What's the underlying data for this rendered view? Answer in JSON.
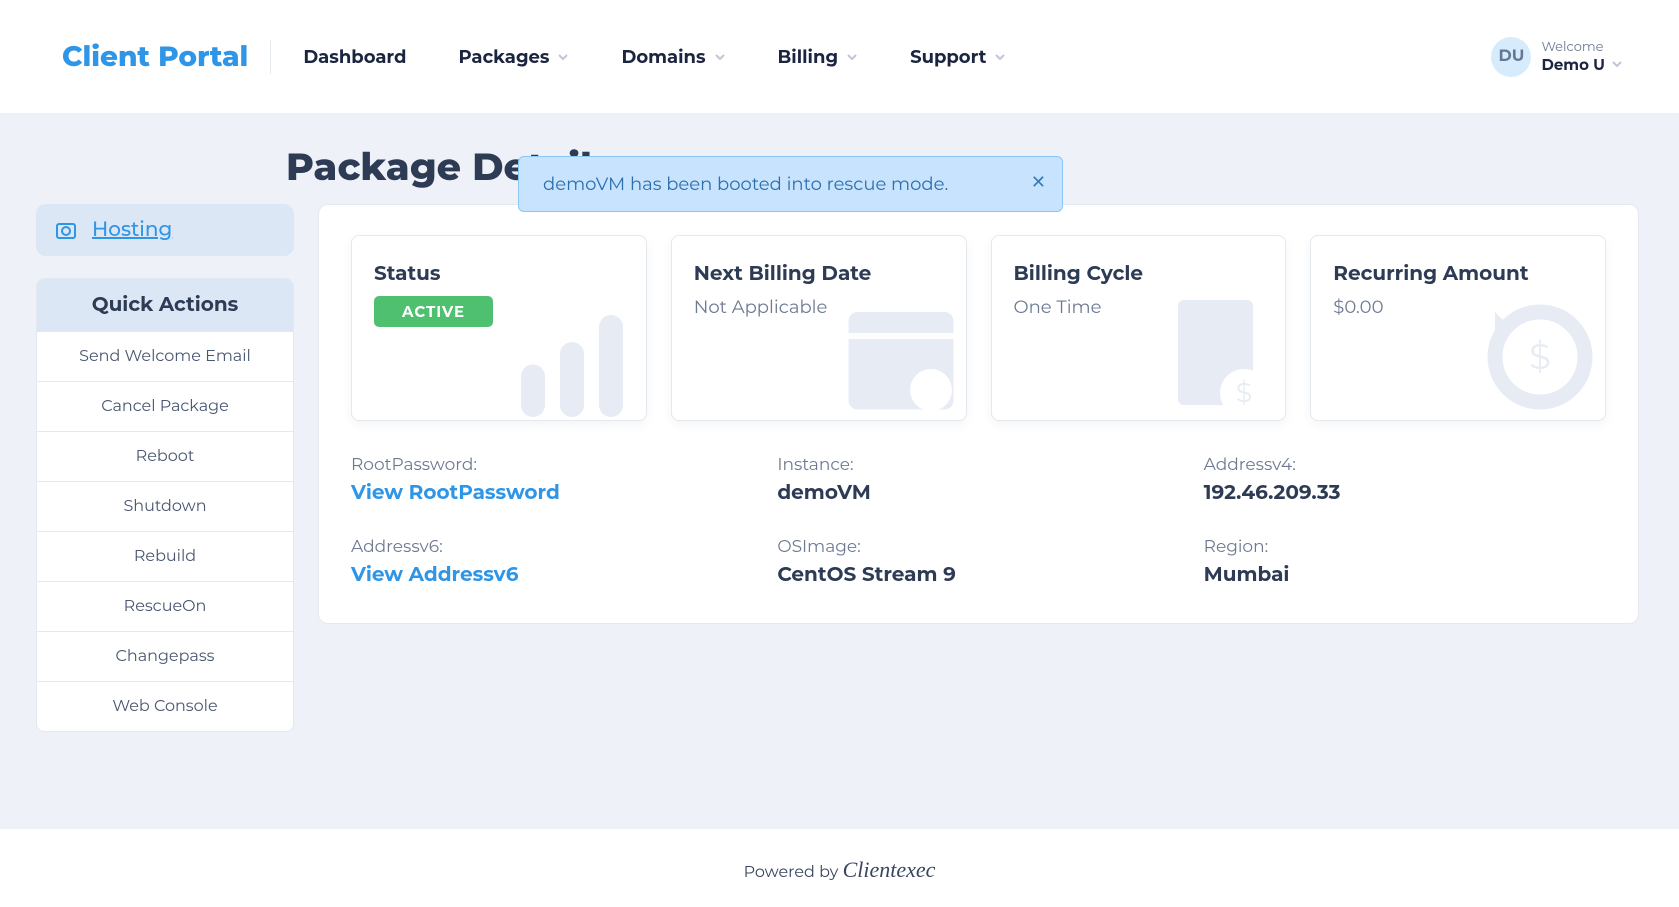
{
  "brand": "Client Portal",
  "nav": {
    "items": [
      {
        "label": "Dashboard",
        "dropdown": false
      },
      {
        "label": "Packages",
        "dropdown": true
      },
      {
        "label": "Domains",
        "dropdown": true
      },
      {
        "label": "Billing",
        "dropdown": true
      },
      {
        "label": "Support",
        "dropdown": true
      }
    ]
  },
  "user": {
    "welcome": "Welcome",
    "name": "Demo U",
    "initials": "DU"
  },
  "page_title": "Package Details",
  "sidebar": {
    "hosting_label": "Hosting",
    "quick_actions_title": "Quick Actions",
    "quick_actions": [
      "Send Welcome Email",
      "Cancel Package",
      "Reboot",
      "Shutdown",
      "Rebuild",
      "RescueOn",
      "Changepass",
      "Web Console"
    ]
  },
  "alert": {
    "message": "demoVM has been booted into rescue mode."
  },
  "cards": {
    "status": {
      "title": "Status",
      "badge": "ACTIVE"
    },
    "next_bill": {
      "title": "Next Billing Date",
      "value": "Not Applicable"
    },
    "cycle": {
      "title": "Billing Cycle",
      "value": "One Time"
    },
    "recurring": {
      "title": "Recurring Amount",
      "value": "$0.00"
    }
  },
  "details": {
    "root_password": {
      "label": "RootPassword:",
      "link_text": "View RootPassword"
    },
    "instance": {
      "label": "Instance:",
      "value": "demoVM"
    },
    "address_v4": {
      "label": "Addressv4:",
      "value": "192.46.209.33"
    },
    "address_v6": {
      "label": "Addressv6:",
      "link_text": "View Addressv6"
    },
    "os_image": {
      "label": "OSImage:",
      "value": "CentOS Stream 9"
    },
    "region": {
      "label": "Region:",
      "value": "Mumbai"
    }
  },
  "footer": {
    "powered_by": "Powered by ",
    "product": "Clientexec"
  }
}
